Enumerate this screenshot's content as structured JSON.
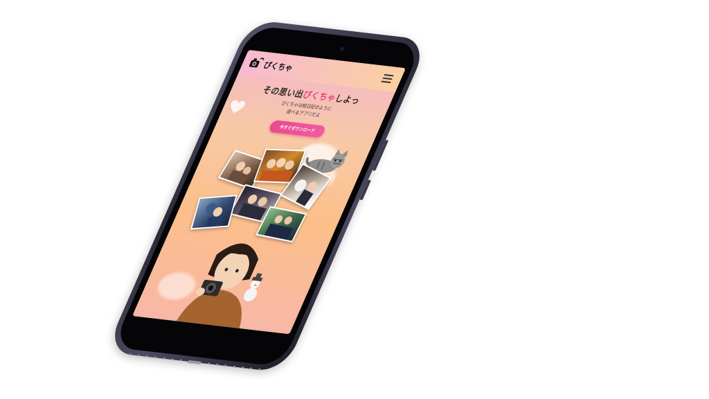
{
  "app": {
    "logo_text": "ぴくちゃ"
  },
  "header": {
    "menu_icon": "hamburger-menu-icon"
  },
  "hero": {
    "headline_before": "その思い出",
    "headline_accent": "ぴくちゃ",
    "headline_after": "しよっ",
    "subtext_line1": "ぴくちゃは絵日記のように",
    "subtext_line2": "遊べるアプリだよ",
    "cta_label": "今すぐダウンロード"
  },
  "colors": {
    "accent": "#e8417f",
    "cta": "#ee4f95",
    "phone_frame": "#3a3950"
  }
}
